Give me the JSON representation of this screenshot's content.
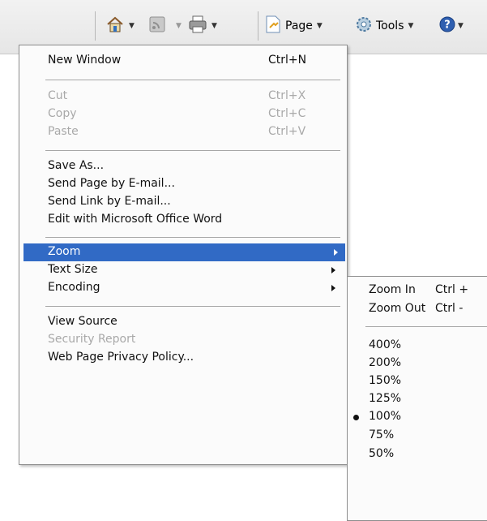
{
  "toolbar": {
    "page_label": "Page",
    "tools_label": "Tools"
  },
  "menu": {
    "items": [
      {
        "label": "New Window",
        "shortcut": "Ctrl+N"
      },
      {
        "label": "Cut",
        "shortcut": "Ctrl+X"
      },
      {
        "label": "Copy",
        "shortcut": "Ctrl+C"
      },
      {
        "label": "Paste",
        "shortcut": "Ctrl+V"
      },
      {
        "label": "Save As..."
      },
      {
        "label": "Send Page by E-mail..."
      },
      {
        "label": "Send Link by E-mail..."
      },
      {
        "label": "Edit with Microsoft Office Word"
      },
      {
        "label": "Zoom"
      },
      {
        "label": "Text Size"
      },
      {
        "label": "Encoding"
      },
      {
        "label": "View Source"
      },
      {
        "label": "Security Report"
      },
      {
        "label": "Web Page Privacy Policy..."
      }
    ]
  },
  "zoom_submenu": {
    "items": [
      {
        "label": "Zoom In",
        "shortcut": "Ctrl +"
      },
      {
        "label": "Zoom Out",
        "shortcut": "Ctrl -"
      },
      {
        "label": "400%"
      },
      {
        "label": "200%"
      },
      {
        "label": "150%"
      },
      {
        "label": "125%"
      },
      {
        "label": "100%"
      },
      {
        "label": "75%"
      },
      {
        "label": "50%"
      }
    ],
    "selected": "100%"
  },
  "colors": {
    "highlight": "#316ac5",
    "disabled_text": "#a9a9a9"
  }
}
